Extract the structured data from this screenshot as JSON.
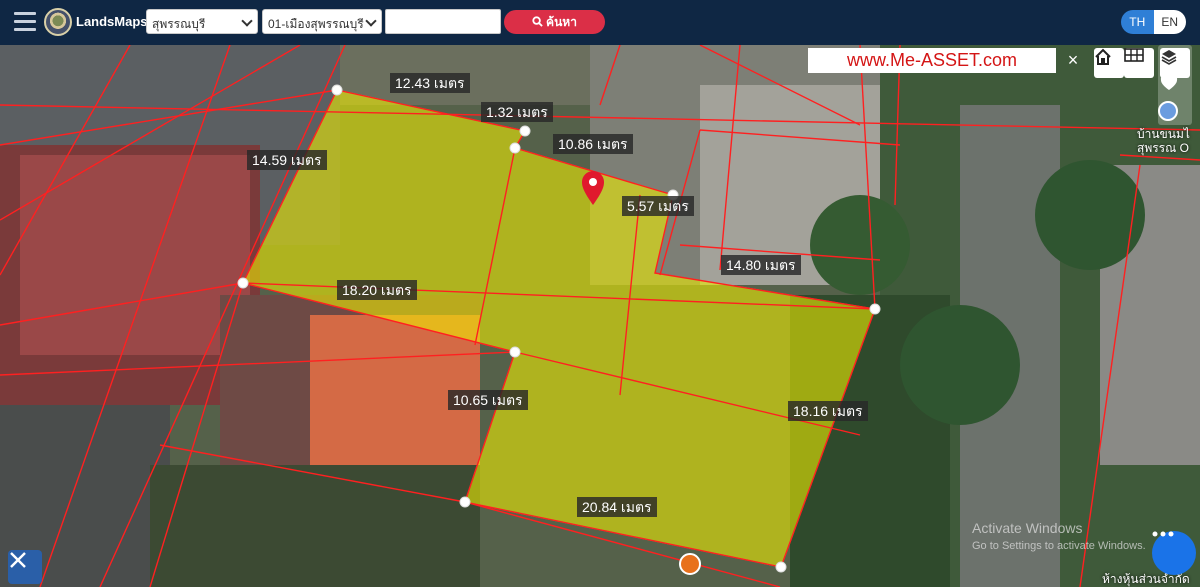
{
  "header": {
    "brand": "LandsMaps",
    "province": "สุพรรณบุรี",
    "district": "01-เมืองสุพรรณบุรี",
    "search_value": "",
    "search_button": "ค้นหา",
    "lang_th": "TH",
    "lang_en": "EN"
  },
  "map": {
    "watermark": "www.Me-ASSET.com",
    "close_symbol": "×",
    "dimensions": [
      "12.43 เมตร",
      "1.32 เมตร",
      "10.86 เมตร",
      "14.59 เมตร",
      "5.57 เมตร",
      "14.80 เมตร",
      "18.20 เมตร",
      "10.65 เมตร",
      "18.16 เมตร",
      "20.84 เมตร"
    ],
    "place_label_1": "บ้านขนมไ",
    "place_label_2": "สุพรรณ O",
    "place_label_3": "ห้างหุ้นส่วนจำกัด",
    "activate_title": "Activate Windows",
    "activate_sub": "Go to Settings to activate Windows.",
    "icons": [
      "menu-icon",
      "home-icon",
      "grid-icon",
      "layers-icon",
      "heart-icon",
      "map-pin-icon",
      "chat-icon",
      "tools-icon"
    ],
    "colors": {
      "parcel_fill": "#f2f000",
      "boundary": "#ff2020",
      "pin": "#e0192d",
      "accent": "#db2f47"
    }
  }
}
